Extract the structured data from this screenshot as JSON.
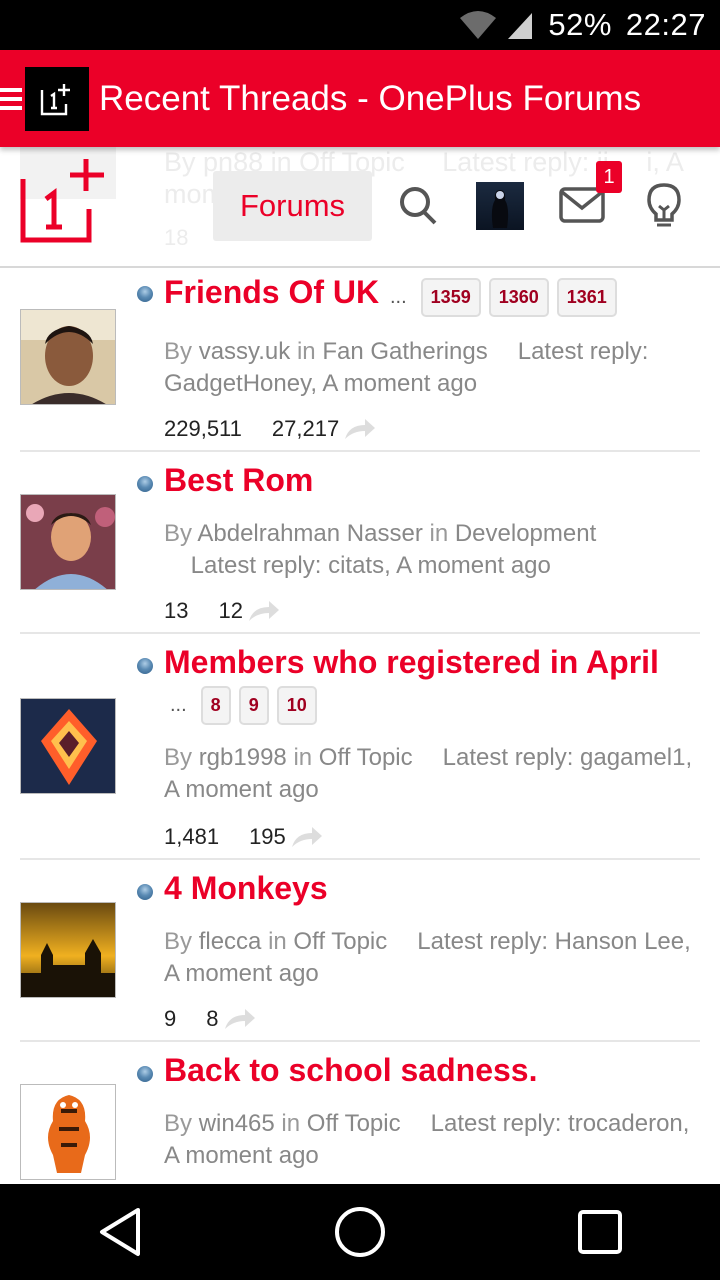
{
  "status_bar": {
    "battery": "52%",
    "time": "22:27"
  },
  "app_bar": {
    "title": "Recent Threads - OnePlus Forums"
  },
  "header": {
    "forums_label": "Forums",
    "mail_badge": "1",
    "ghost_row": {
      "author_prefix": "By",
      "author": "pn88",
      "in": "in",
      "forum": "Off Topic",
      "latest": "Latest reply: ji",
      "latest_tail": "i, A",
      "time": "mom",
      "replies": "18"
    }
  },
  "threads": [
    {
      "title": "Friends Of UK",
      "pages": [
        "1359",
        "1360",
        "1361"
      ],
      "ellipsis": "...",
      "by": "By",
      "author": "vassy.uk",
      "in": "in",
      "forum": "Fan Gatherings",
      "latest_label": "Latest reply:",
      "latest_text": "GadgetHoney, A moment ago",
      "replies": "229,511",
      "views": "27,217"
    },
    {
      "title": "Best Rom",
      "by": "By",
      "author": "Abdelrahman Nasser",
      "in": "in",
      "forum": "Development",
      "latest_label": "Latest reply:",
      "latest_text": "citats, A moment ago",
      "replies": "13",
      "views": "12"
    },
    {
      "title": "Members who registered in April",
      "pages": [
        "8",
        "9",
        "10"
      ],
      "ellipsis": "...",
      "by": "By",
      "author": "rgb1998",
      "in": "in",
      "forum": "Off Topic",
      "latest_label": "Latest reply:",
      "latest_text": "gagamel1, A moment ago",
      "replies": "1,481",
      "views": "195"
    },
    {
      "title": "4 Monkeys",
      "by": "By",
      "author": "flecca",
      "in": "in",
      "forum": "Off Topic",
      "latest_label": "Latest reply: Hanson",
      "latest_text": "Lee, A moment ago",
      "replies": "9",
      "views": "8"
    },
    {
      "title": "Back to school sadness.",
      "by": "By",
      "author": "win465",
      "in": "in",
      "forum": "Off Topic",
      "latest_label": "Latest reply:",
      "latest_text": "trocaderon, A moment ago"
    }
  ],
  "icons": {
    "drawer": "menu-icon",
    "search": "search-icon",
    "mail": "mail-icon",
    "bulb": "lightbulb-icon",
    "share": "share-icon",
    "back": "back-icon",
    "home": "home-icon",
    "recents": "recents-icon"
  },
  "colors": {
    "accent": "#eb0028",
    "status_bar": "#000000",
    "muted_text": "#999999"
  }
}
